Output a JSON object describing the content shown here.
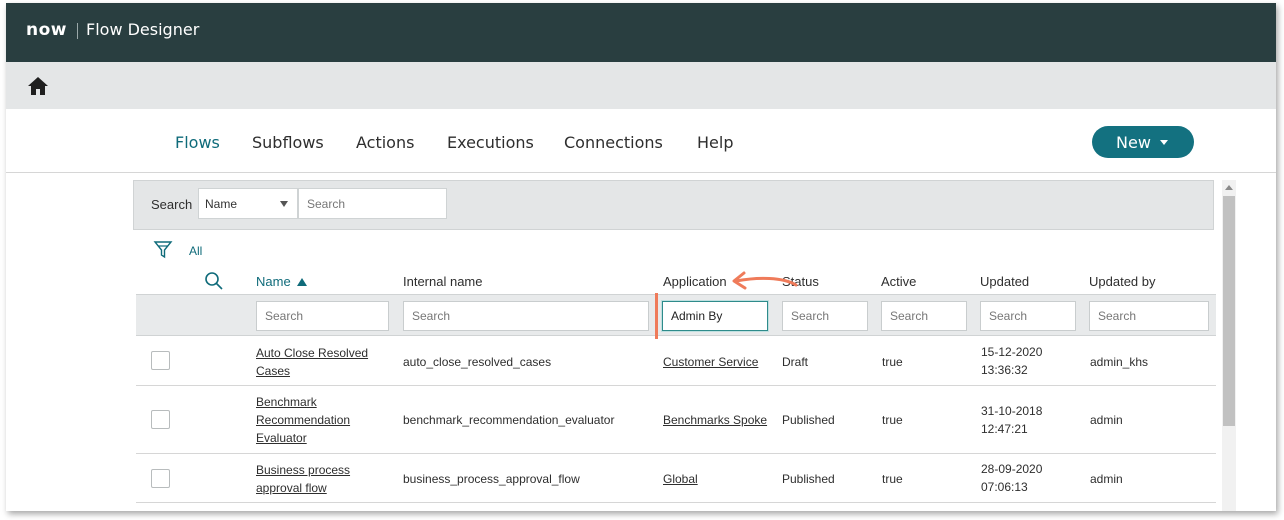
{
  "header": {
    "logo": "now",
    "title": "Flow Designer"
  },
  "nav": {
    "tabs": [
      {
        "label": "Flows",
        "active": true
      },
      {
        "label": "Subflows"
      },
      {
        "label": "Actions"
      },
      {
        "label": "Executions"
      },
      {
        "label": "Connections"
      },
      {
        "label": "Help"
      }
    ],
    "new_button": "New"
  },
  "search": {
    "label": "Search",
    "field_value": "Name",
    "placeholder": "Search"
  },
  "filter": {
    "label": "All"
  },
  "table": {
    "columns": [
      "Name",
      "Internal name",
      "Application",
      "Status",
      "Active",
      "Updated",
      "Updated by"
    ],
    "filters": {
      "name": "",
      "internal": "",
      "application": "Admin By",
      "status": "",
      "active": "",
      "updated": "",
      "updated_by": "",
      "placeholder": "Search"
    },
    "rows": [
      {
        "name_l1": "Auto Close Resolved",
        "name_l2": "Cases",
        "name_l3": "",
        "internal": "auto_close_resolved_cases",
        "application": "Customer Service",
        "status": "Draft",
        "active": "true",
        "updated_date": "15-12-2020",
        "updated_time": "13:36:32",
        "updated_by": "admin_khs"
      },
      {
        "name_l1": "Benchmark",
        "name_l2": "Recommendation",
        "name_l3": "Evaluator",
        "internal": "benchmark_recommendation_evaluator",
        "application": "Benchmarks Spoke",
        "status": "Published",
        "active": "true",
        "updated_date": "31-10-2018",
        "updated_time": "12:47:21",
        "updated_by": "admin"
      },
      {
        "name_l1": "Business process",
        "name_l2": "approval flow",
        "name_l3": "",
        "internal": "business_process_approval_flow",
        "application": "Global",
        "status": "Published",
        "active": "true",
        "updated_date": "28-09-2020",
        "updated_time": "07:06:13",
        "updated_by": "admin"
      }
    ]
  },
  "colors": {
    "topbar": "#293e40",
    "accent": "#137180",
    "annotation": "#ef7b5a"
  }
}
